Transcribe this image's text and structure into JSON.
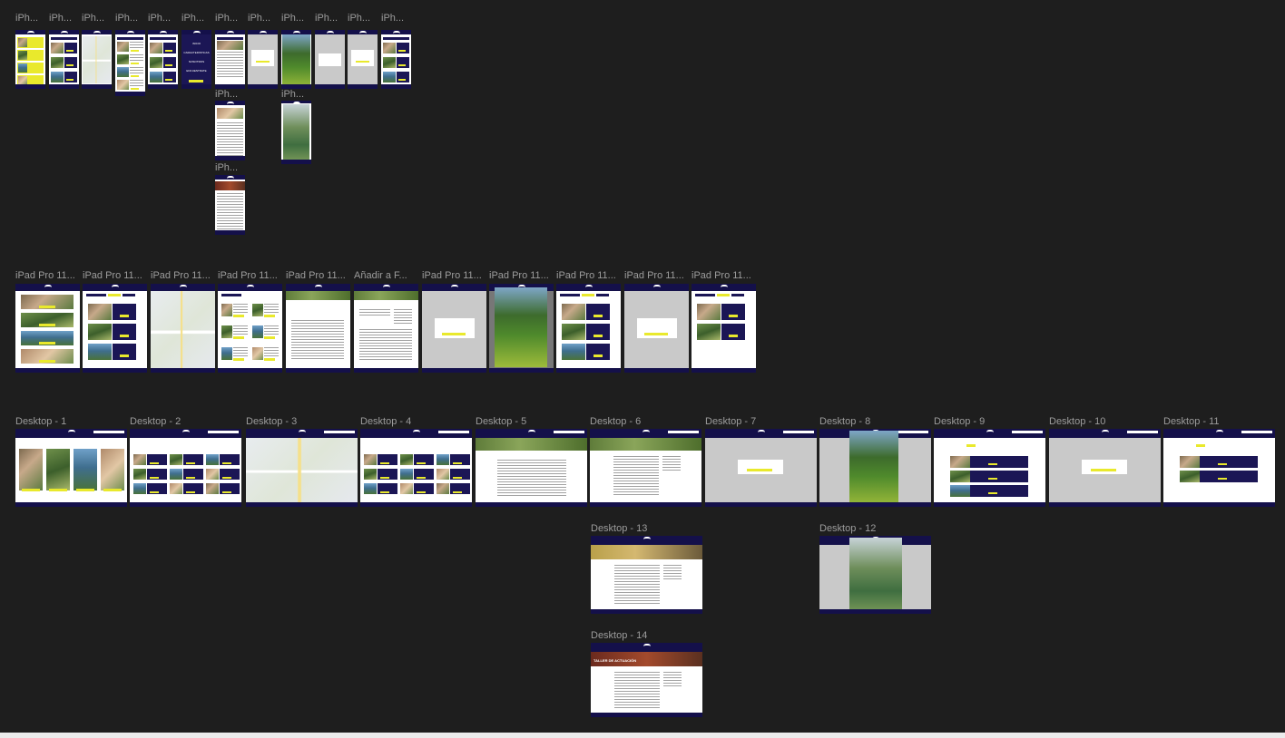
{
  "canvas": {
    "background": "#1e1e1e"
  },
  "colors": {
    "navy": "#14104a",
    "yellow": "#e9e92c",
    "label": "#9c9c9c"
  },
  "rows": {
    "iphone_labels": [
      "iPh...",
      "iPh...",
      "iPh...",
      "iPh...",
      "iPh...",
      "iPh...",
      "iPh...",
      "iPh...",
      "iPh...",
      "iPh...",
      "iPh...",
      "iPh..."
    ],
    "iphone_stack_labels": [
      "iPh...",
      "iPh...",
      "iPh..."
    ],
    "ipad_labels": [
      "iPad Pro 11...",
      "iPad Pro 11...",
      "iPad Pro 11...",
      "iPad Pro 11...",
      "iPad Pro 11...",
      "Añadir a F...",
      "iPad Pro 11...",
      "iPad Pro 11...",
      "iPad Pro 11...",
      "iPad Pro 11...",
      "iPad Pro 11..."
    ],
    "desktop_labels": [
      "Desktop - 1",
      "Desktop - 2",
      "Desktop - 3",
      "Desktop - 4",
      "Desktop - 5",
      "Desktop - 6",
      "Desktop - 7",
      "Desktop - 8",
      "Desktop - 9",
      "Desktop - 10",
      "Desktop - 11"
    ],
    "desktop_extra_labels": {
      "d13": "Desktop - 13",
      "d12": "Desktop - 12",
      "d14": "Desktop - 14"
    }
  },
  "iphone_menu": [
    "INICIO",
    "CARACTERISTICAS",
    "NOSOTROS",
    "ENCUENTRATE"
  ],
  "desktop_titles": {
    "d2": "EVENTOS",
    "d4": "PARQUES",
    "d6": "EVENTO DE FÚTBOL",
    "d9": "MIS FAVORITOS",
    "d11": "MIS FAVORITOS",
    "d5_heading": "PROYECTO RECUPERACIÓN LOS JARDINES",
    "d14_banner": "TALLER DE ACTUACIÓN"
  },
  "desktop1_cards": [
    "EVENTOS",
    "PARQUES",
    "MAPA",
    "FAVORITOS"
  ]
}
